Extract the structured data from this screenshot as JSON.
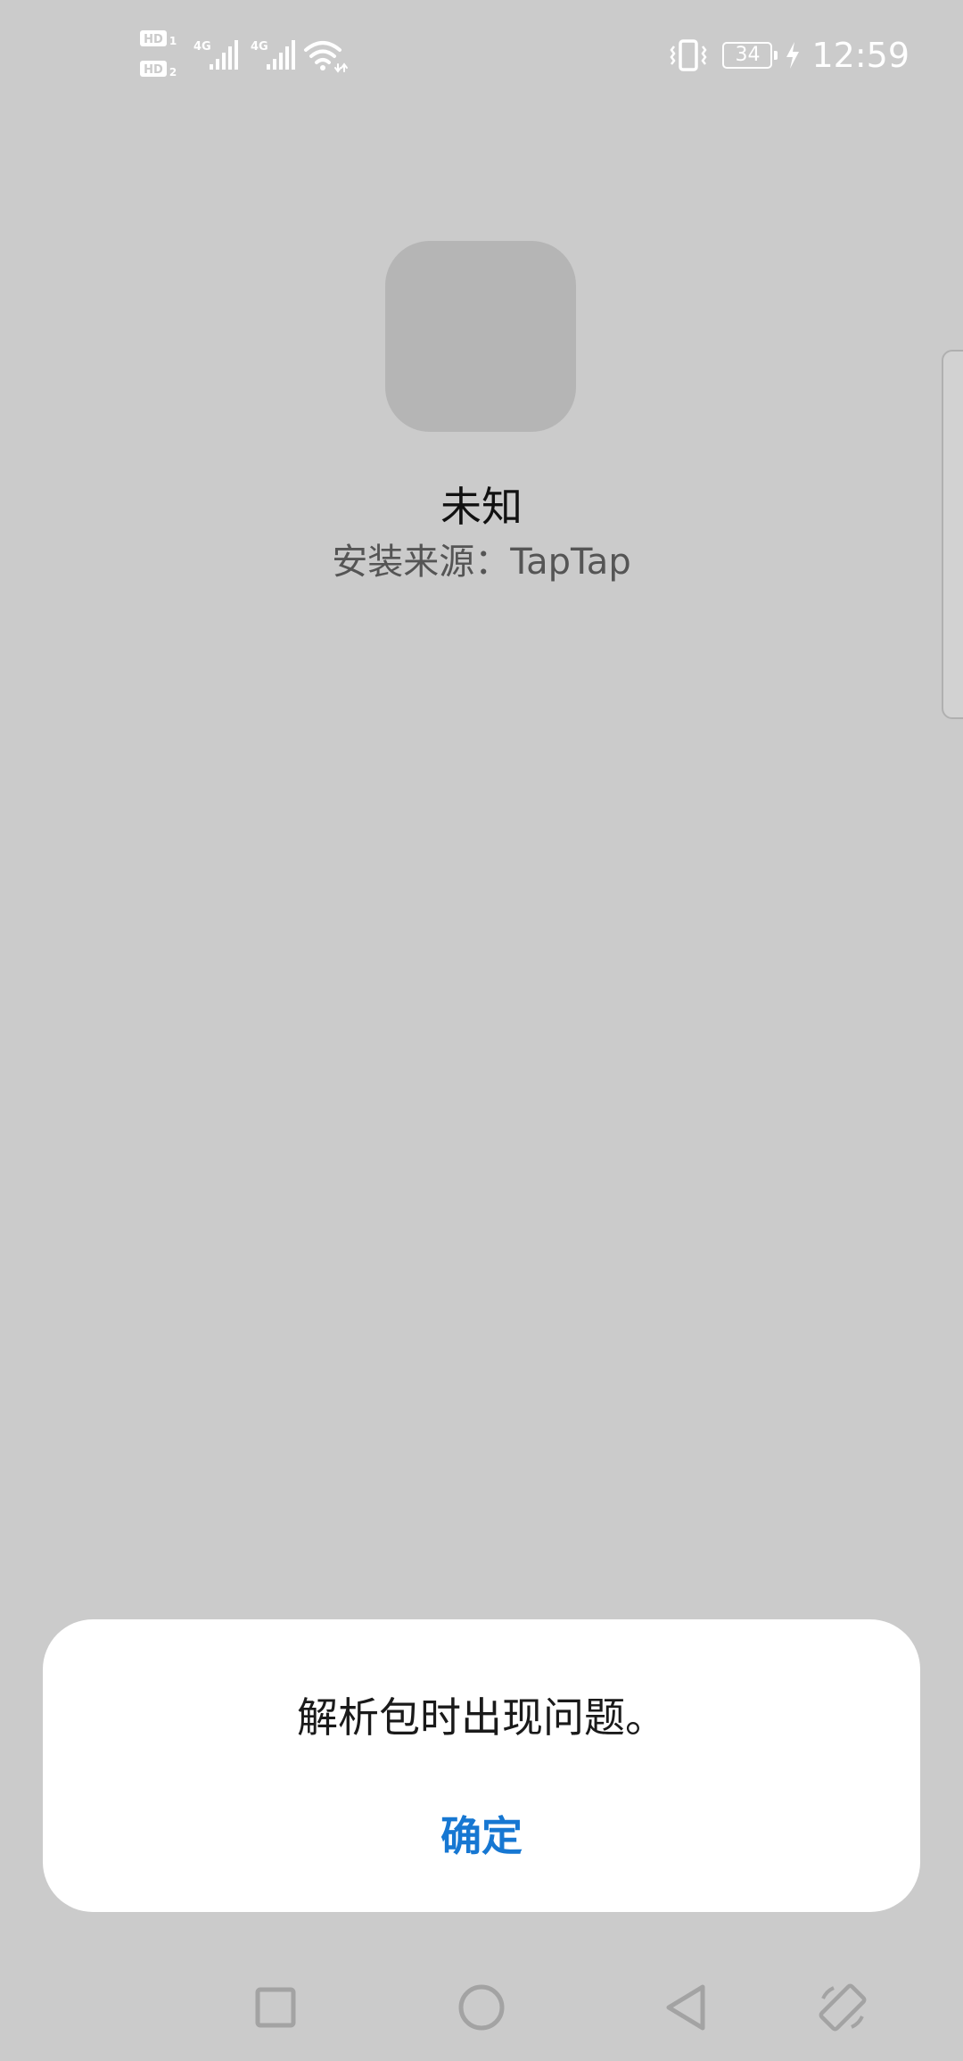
{
  "status_bar": {
    "sim1_label": "HD",
    "sim1_index": "1",
    "sim2_label": "HD",
    "sim2_index": "2",
    "network1": "4G",
    "network2": "4G",
    "battery_level": "34",
    "time": "12:59",
    "icon_color": "#ffffff"
  },
  "app": {
    "name": "未知",
    "install_source": "安装来源：TapTap"
  },
  "dialog": {
    "message": "解析包时出现问题。",
    "ok_label": "确定",
    "accent_color": "#1677d2"
  },
  "nav_bar": {
    "icons": [
      "recents-square-icon",
      "home-circle-icon",
      "back-triangle-icon",
      "rotate-screen-icon"
    ]
  }
}
